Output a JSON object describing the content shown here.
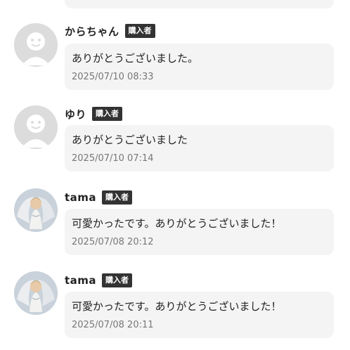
{
  "comments": [
    {
      "user": "からちゃん",
      "badge": "購入者",
      "message": "ありがとうございました。",
      "timestamp": "2025/07/10 08:33",
      "avatar": "default-user-icon"
    },
    {
      "user": "ゆり",
      "badge": "購入者",
      "message": "ありがとうございました",
      "timestamp": "2025/07/10 07:14",
      "avatar": "default-user-icon"
    },
    {
      "user": "tama",
      "badge": "購入者",
      "message": "可愛かったです。ありがとうございました！",
      "timestamp": "2025/07/08 20:12",
      "avatar": "angel-photo"
    },
    {
      "user": "tama",
      "badge": "購入者",
      "message": "可愛かったです。ありがとうございました！",
      "timestamp": "2025/07/08 20:11",
      "avatar": "angel-photo"
    }
  ],
  "colors": {
    "bubble": "#f4f4f4",
    "badge": "#333333",
    "avatar_default": "#dcdcdc",
    "timestamp": "#777777"
  }
}
